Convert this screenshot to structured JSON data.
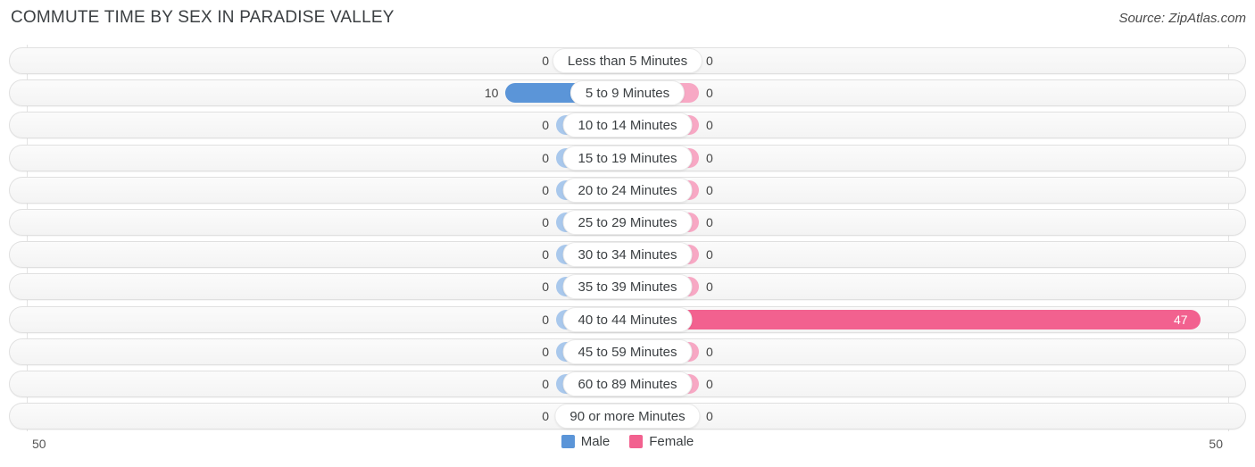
{
  "header": {
    "title": "COMMUTE TIME BY SEX IN PARADISE VALLEY",
    "source": "Source: ZipAtlas.com"
  },
  "legend": {
    "male_label": "Male",
    "female_label": "Female",
    "male_color": "#5b95d8",
    "female_color": "#f2618f"
  },
  "axis": {
    "left_label": "50",
    "right_label": "50"
  },
  "chart_data": {
    "type": "bar",
    "subtype": "diverging-horizontal-bar",
    "title": "COMMUTE TIME BY SEX IN PARADISE VALLEY",
    "xlabel": "",
    "ylabel": "",
    "xlim": [
      -50,
      50
    ],
    "axis_ticks": [
      "50",
      "50"
    ],
    "grid": true,
    "legend_position": "bottom-center",
    "categories": [
      "Less than 5 Minutes",
      "5 to 9 Minutes",
      "10 to 14 Minutes",
      "15 to 19 Minutes",
      "20 to 24 Minutes",
      "25 to 29 Minutes",
      "30 to 34 Minutes",
      "35 to 39 Minutes",
      "40 to 44 Minutes",
      "45 to 59 Minutes",
      "60 to 89 Minutes",
      "90 or more Minutes"
    ],
    "series": [
      {
        "name": "Male",
        "color": "#5b95d8",
        "values": [
          0,
          10,
          0,
          0,
          0,
          0,
          0,
          0,
          0,
          0,
          0,
          0
        ],
        "labels": [
          "0",
          "10",
          "0",
          "0",
          "0",
          "0",
          "0",
          "0",
          "0",
          "0",
          "0",
          "0"
        ]
      },
      {
        "name": "Female",
        "color": "#f2618f",
        "values": [
          0,
          0,
          0,
          0,
          0,
          0,
          0,
          0,
          47,
          0,
          0,
          0
        ],
        "labels": [
          "0",
          "0",
          "0",
          "0",
          "0",
          "0",
          "0",
          "0",
          "47",
          "0",
          "0",
          "0"
        ]
      }
    ]
  }
}
